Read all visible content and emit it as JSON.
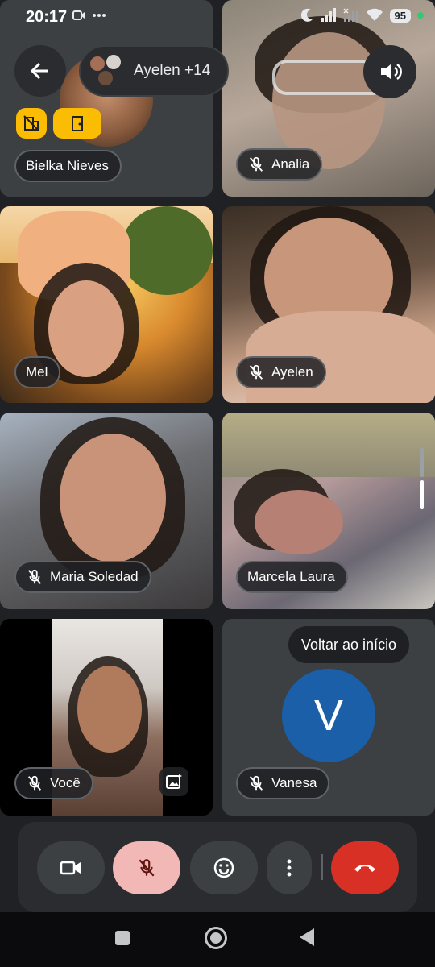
{
  "status_bar": {
    "time": "20:17",
    "battery": "95",
    "icons": [
      "video-recording-icon",
      "more-dots-icon",
      "moon-icon",
      "signal-icon",
      "signal-x-icon",
      "wifi-icon",
      "battery-icon"
    ]
  },
  "header": {
    "back_icon": "arrow-left-icon",
    "participants_label": "Ayelen +14",
    "speaker_icon": "volume-icon"
  },
  "tiles": [
    {
      "name": "Bielka Nieves",
      "muted": false
    },
    {
      "name": "Analia",
      "muted": true
    },
    {
      "name": "Mel",
      "muted": false
    },
    {
      "name": "Ayelen",
      "muted": true
    },
    {
      "name": "Maria Soledad",
      "muted": true
    },
    {
      "name": "Marcela Laura",
      "muted": false
    },
    {
      "name": "Você",
      "muted": true
    },
    {
      "name": "Vanesa",
      "muted": true,
      "avatar_letter": "V"
    }
  ],
  "tooltip": "Voltar ao início",
  "controls": {
    "camera_icon": "camera-icon",
    "mic_icon": "mic-off-icon",
    "emoji_icon": "emoji-icon",
    "more_icon": "more-vert-icon",
    "hangup_icon": "hangup-icon"
  },
  "colors": {
    "background": "#202124",
    "tile": "#3c4043",
    "hangup": "#d93025",
    "mic_active": "#f2b8b5",
    "avatar_v": "#1a5fa8",
    "host_badge": "#fbbc04"
  }
}
